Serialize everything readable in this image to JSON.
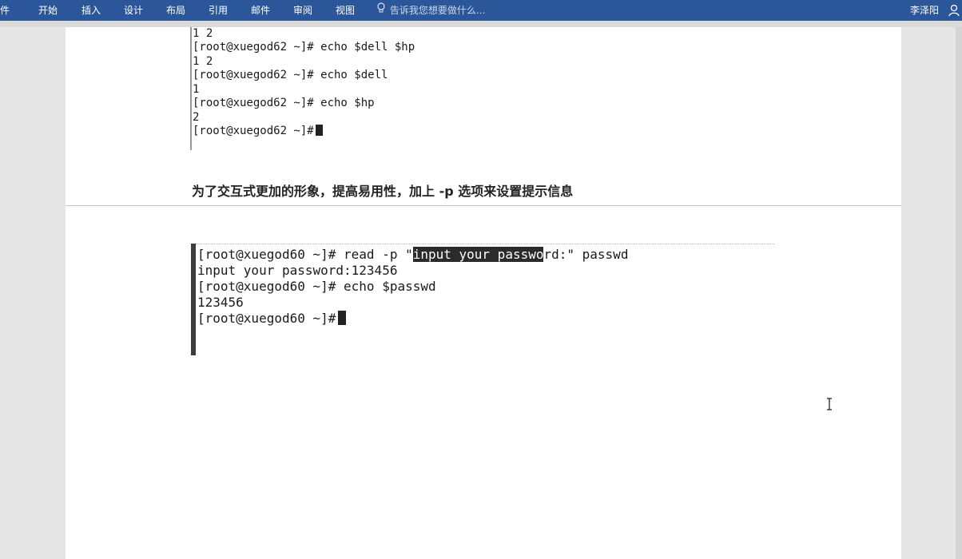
{
  "ribbon": {
    "tabs": [
      {
        "label": "件"
      },
      {
        "label": "开始"
      },
      {
        "label": "插入"
      },
      {
        "label": "设计"
      },
      {
        "label": "布局"
      },
      {
        "label": "引用"
      },
      {
        "label": "邮件"
      },
      {
        "label": "审阅"
      },
      {
        "label": "视图"
      }
    ],
    "tell_me": "告诉我您想要做什么...",
    "user_name": "李泽阳",
    "colors": {
      "ribbon_bg": "#2b579a"
    }
  },
  "terminal1": {
    "lines": [
      "1 2",
      "[root@xuegod62 ~]# echo $dell $hp",
      "1 2",
      "[root@xuegod62 ~]# echo $dell",
      "1",
      "[root@xuegod62 ~]# echo $hp",
      "2",
      "[root@xuegod62 ~]#"
    ]
  },
  "instruction": "为了交互式更加的形象，提高易用性，加上 -p 选项来设置提示信息",
  "terminal2": {
    "line1_prefix": "[root@xuegod60 ~]# read -p \"",
    "line1_highlight": "input your passwo",
    "line1_suffix": "rd:\" passwd",
    "lines": [
      "input your password:123456",
      "[root@xuegod60 ~]# echo $passwd",
      "123456",
      "[root@xuegod60 ~]#"
    ]
  }
}
